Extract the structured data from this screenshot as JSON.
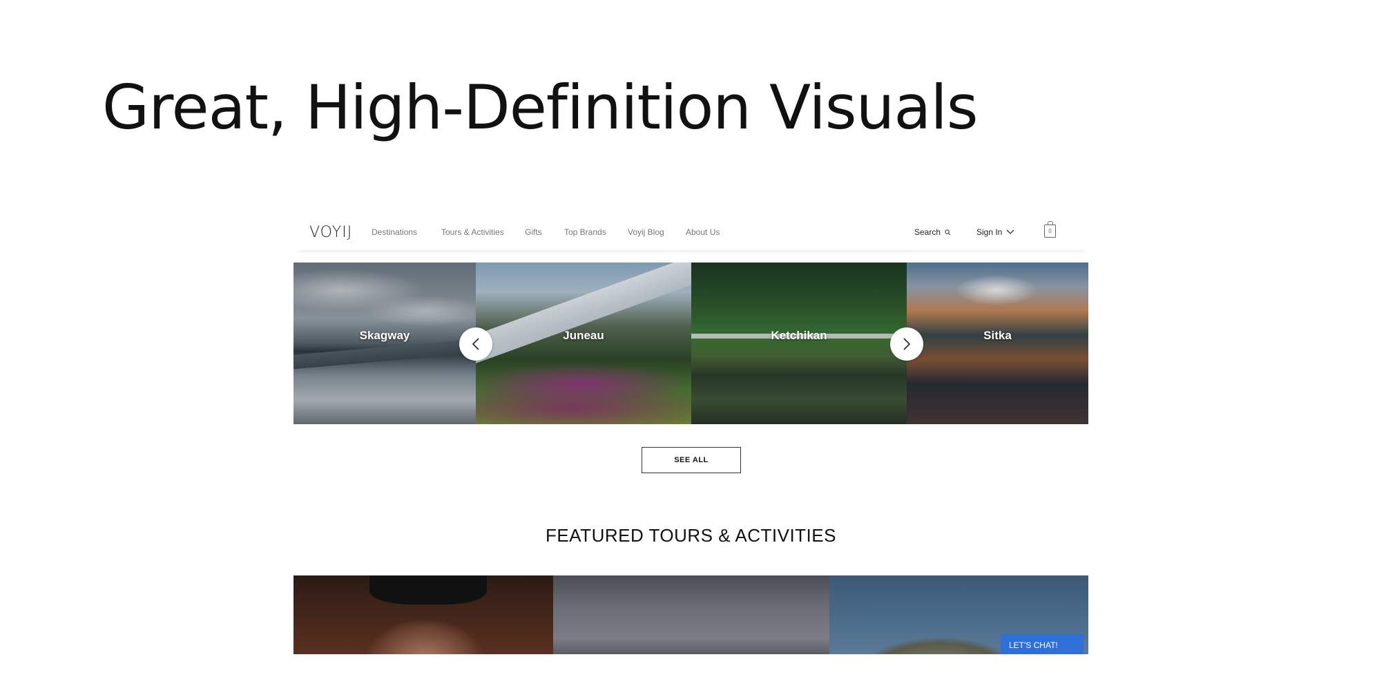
{
  "slide": {
    "title": "Great, High-Definition Visuals"
  },
  "header": {
    "logo": "VOYIJ",
    "nav": [
      "Destinations",
      "Tours & Activities",
      "Gifts",
      "Top Brands",
      "Voyij Blog",
      "About Us"
    ],
    "search_label": "Search",
    "signin_label": "Sign In",
    "cart_count": "0"
  },
  "destinations": [
    {
      "label": "Skagway"
    },
    {
      "label": "Juneau"
    },
    {
      "label": "Ketchikan"
    },
    {
      "label": "Sitka"
    }
  ],
  "see_all_label": "SEE ALL",
  "featured": {
    "title": "FEATURED TOURS & ACTIVITIES"
  },
  "chat": {
    "label": "LET'S CHAT!"
  },
  "colors": {
    "chat_blue": "#2f6fd8",
    "nav_gray": "#777777"
  }
}
